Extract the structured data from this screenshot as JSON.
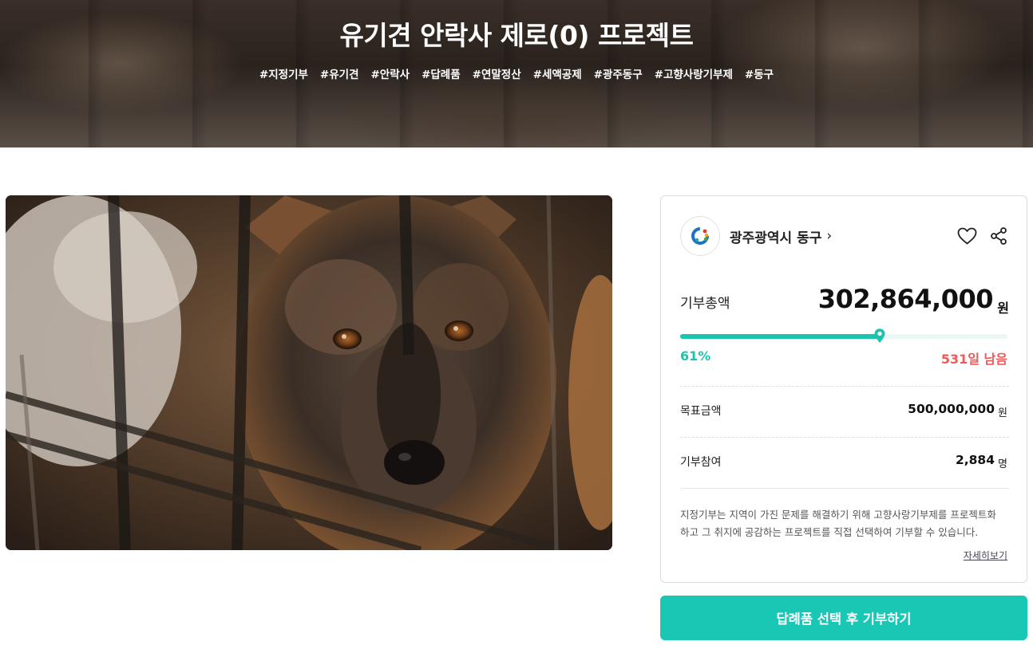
{
  "hero": {
    "title": "유기견 안락사 제로(0) 프로젝트",
    "hashtags": [
      "#지정기부",
      "#유기견",
      "#안락사",
      "#답례품",
      "#연말정산",
      "#세액공제",
      "#광주동구",
      "#고향사랑기부제",
      "#동구"
    ]
  },
  "organization": {
    "name": "광주광역시 동구",
    "chevron": "›",
    "logo_icon": "gwangju-donggu-logo",
    "like_icon": "heart-icon",
    "share_icon": "share-icon"
  },
  "donation": {
    "total_label": "기부총액",
    "total_value": "302,864,000",
    "total_unit": "원",
    "progress_fraction": 0.61,
    "progress_percent": "61%",
    "remaining": "531일 남음",
    "goal_label": "목표금액",
    "goal_value": "500,000,000",
    "goal_unit": "원",
    "participants_label": "기부참여",
    "participants_value": "2,884",
    "participants_unit": "명"
  },
  "description": {
    "line1": "지정기부는 지역이 가진 문제를 해결하기 위해 고향사랑기부제를 프로젝트화",
    "line2": "하고 그 취지에 공감하는 프로젝트를 직접 선택하여 기부할 수 있습니다.",
    "more_link": "자세히보기"
  },
  "cta": {
    "label": "답례품 선택 후 기부하기"
  },
  "colors": {
    "accent": "#19c8b4",
    "progress": "#1cc3ad",
    "remaining": "#ee5a5a"
  }
}
